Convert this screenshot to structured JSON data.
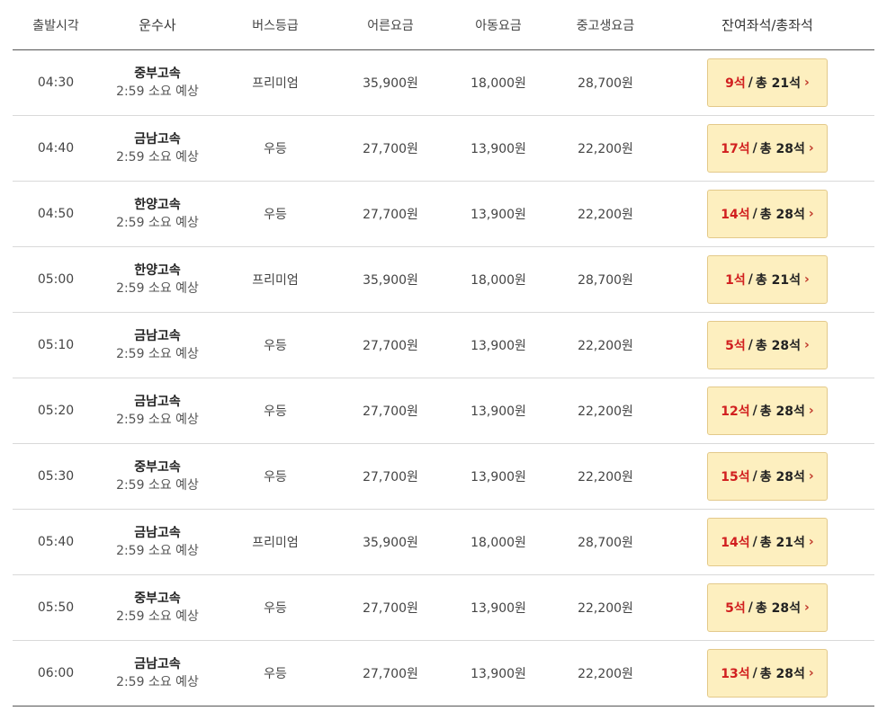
{
  "header": {
    "departure": "출발시각",
    "company": "운수사",
    "grade": "버스등급",
    "adult": "어른요금",
    "child": "아동요금",
    "student": "중고생요금",
    "seats": "잔여좌석/총좌석"
  },
  "rows": [
    {
      "time": "04:30",
      "company": "중부고속",
      "duration": "2:59 소요 예상",
      "grade": "프리미엄",
      "adult": "35,900원",
      "child": "18,000원",
      "student": "28,700원",
      "remaining": "9석",
      "total": "총 21석"
    },
    {
      "time": "04:40",
      "company": "금남고속",
      "duration": "2:59 소요 예상",
      "grade": "우등",
      "adult": "27,700원",
      "child": "13,900원",
      "student": "22,200원",
      "remaining": "17석",
      "total": "총 28석"
    },
    {
      "time": "04:50",
      "company": "한양고속",
      "duration": "2:59 소요 예상",
      "grade": "우등",
      "adult": "27,700원",
      "child": "13,900원",
      "student": "22,200원",
      "remaining": "14석",
      "total": "총 28석"
    },
    {
      "time": "05:00",
      "company": "한양고속",
      "duration": "2:59 소요 예상",
      "grade": "프리미엄",
      "adult": "35,900원",
      "child": "18,000원",
      "student": "28,700원",
      "remaining": "1석",
      "total": "총 21석"
    },
    {
      "time": "05:10",
      "company": "금남고속",
      "duration": "2:59 소요 예상",
      "grade": "우등",
      "adult": "27,700원",
      "child": "13,900원",
      "student": "22,200원",
      "remaining": "5석",
      "total": "총 28석"
    },
    {
      "time": "05:20",
      "company": "금남고속",
      "duration": "2:59 소요 예상",
      "grade": "우등",
      "adult": "27,700원",
      "child": "13,900원",
      "student": "22,200원",
      "remaining": "12석",
      "total": "총 28석"
    },
    {
      "time": "05:30",
      "company": "중부고속",
      "duration": "2:59 소요 예상",
      "grade": "우등",
      "adult": "27,700원",
      "child": "13,900원",
      "student": "22,200원",
      "remaining": "15석",
      "total": "총 28석"
    },
    {
      "time": "05:40",
      "company": "금남고속",
      "duration": "2:59 소요 예상",
      "grade": "프리미엄",
      "adult": "35,900원",
      "child": "18,000원",
      "student": "28,700원",
      "remaining": "14석",
      "total": "총 21석"
    },
    {
      "time": "05:50",
      "company": "중부고속",
      "duration": "2:59 소요 예상",
      "grade": "우등",
      "adult": "27,700원",
      "child": "13,900원",
      "student": "22,200원",
      "remaining": "5석",
      "total": "총 28석"
    },
    {
      "time": "06:00",
      "company": "금남고속",
      "duration": "2:59 소요 예상",
      "grade": "우등",
      "adult": "27,700원",
      "child": "13,900원",
      "student": "22,200원",
      "remaining": "13석",
      "total": "총 28석"
    }
  ],
  "icons": {
    "seat_button_arrow": "chevron-right-icon"
  },
  "colors": {
    "remaining_seats": "#d11f1f",
    "seat_button_bg": "#fdefbf",
    "seat_button_border": "#e3c98a"
  }
}
